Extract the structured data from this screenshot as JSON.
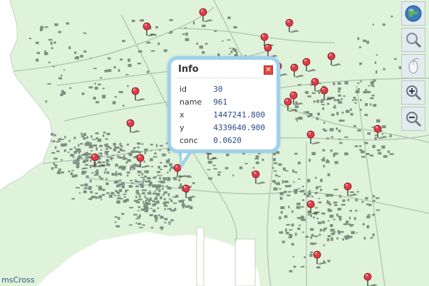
{
  "map": {
    "background_land": "#dff3da",
    "background_sea": "#ffffff",
    "building_color": "#7d8f82",
    "road_color": "#b8c7b6",
    "marker_color": "#e23b48",
    "marker_count": 30
  },
  "toolbar": {
    "tools": [
      {
        "name": "full-extent",
        "icon": "globe-icon"
      },
      {
        "name": "zoom-box",
        "icon": "magnifier-icon"
      },
      {
        "name": "pan",
        "icon": "mouse-icon"
      },
      {
        "name": "zoom-in",
        "icon": "zoom-in-icon"
      },
      {
        "name": "zoom-out",
        "icon": "zoom-out-icon"
      }
    ]
  },
  "popup": {
    "title": "Info",
    "close_symbol": "✕",
    "rows": [
      {
        "key": "id",
        "value": "30"
      },
      {
        "key": "name",
        "value": "961"
      },
      {
        "key": "x",
        "value": "1447241.800"
      },
      {
        "key": "y",
        "value": "4339640.900"
      },
      {
        "key": "conc",
        "value": "0.0620"
      }
    ]
  },
  "credit": "msCross"
}
